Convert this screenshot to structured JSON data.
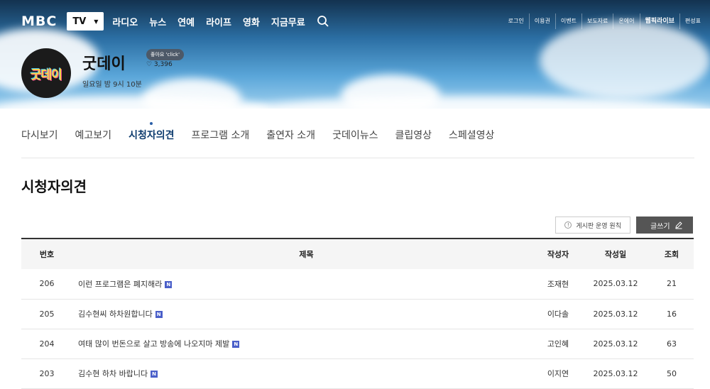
{
  "header": {
    "logo": "MBC",
    "channel_select": "TV",
    "menu": [
      "라디오",
      "뉴스",
      "연예",
      "라이프",
      "영화",
      "지금무료"
    ],
    "search_icon": "search-icon",
    "util_links": [
      "로그인",
      "이용권",
      "이벤트",
      "보도자료",
      "온에어",
      "웹픽라이브",
      "편성표"
    ]
  },
  "program": {
    "title": "굿데이",
    "logo_text": "굿데이",
    "airtime": "일요일 밤 9시 10분",
    "like_badge": "좋아요 'click'",
    "like_count": "♡ 3,396"
  },
  "tabs": [
    "다시보기",
    "예고보기",
    "시청자의견",
    "프로그램 소개",
    "출연자 소개",
    "굿데이뉴스",
    "클립영상",
    "스페셜영상"
  ],
  "active_tab": "시청자의견",
  "section_title": "시청자의견",
  "actions": {
    "rules_button": "게시판 운영 원칙",
    "write_button": "글쓰기"
  },
  "table": {
    "columns": [
      "번호",
      "제목",
      "작성자",
      "작성일",
      "조회"
    ],
    "rows": [
      {
        "no": "206",
        "title": "이런 프로그램은 폐지해라",
        "writer": "조재현",
        "date": "2025.03.12",
        "views": "21"
      },
      {
        "no": "205",
        "title": "김수현씨 하차원합니다",
        "writer": "이다솔",
        "date": "2025.03.12",
        "views": "16"
      },
      {
        "no": "204",
        "title": "여태 많이 번돈으로 살고 방송에 나오지마 제발",
        "writer": "고인혜",
        "date": "2025.03.12",
        "views": "63"
      },
      {
        "no": "203",
        "title": "김수현 하차 바랍니다",
        "writer": "이지연",
        "date": "2025.03.12",
        "views": "50"
      }
    ],
    "new_badge": "N"
  }
}
